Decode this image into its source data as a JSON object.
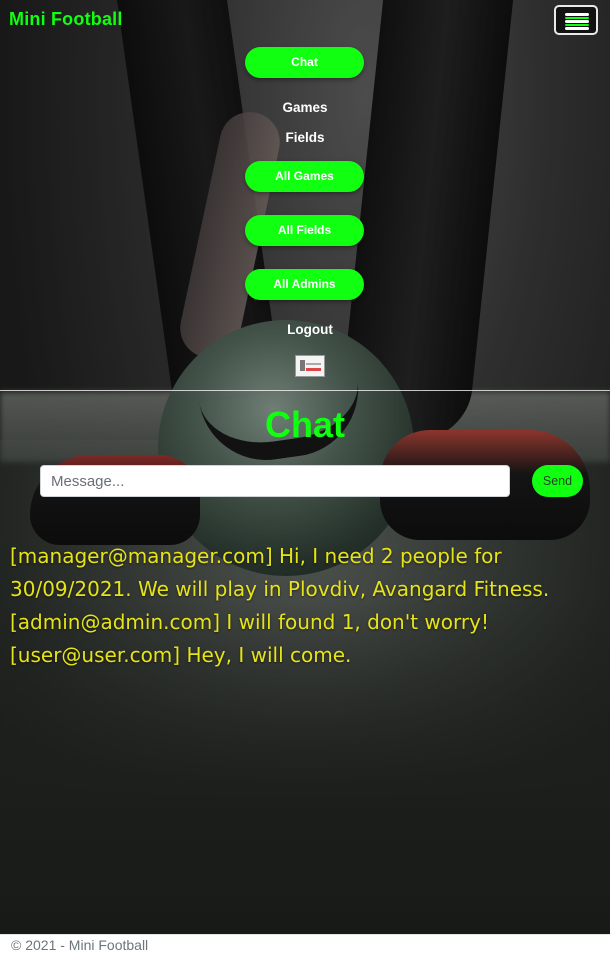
{
  "navbar": {
    "brand": "Mini Football",
    "toggle_icon": "hamburger-menu-icon",
    "items": [
      {
        "label": "Chat",
        "style": "pill"
      },
      {
        "label": "Games",
        "style": "text"
      },
      {
        "label": "Fields",
        "style": "text"
      },
      {
        "label": "All Games",
        "style": "pill"
      },
      {
        "label": "All Fields",
        "style": "pill"
      },
      {
        "label": "All Admins",
        "style": "pill"
      },
      {
        "label": "Logout",
        "style": "text"
      }
    ],
    "profile_icon": "profile-image-icon"
  },
  "chat": {
    "title": "Chat",
    "input_placeholder": "Message...",
    "send_label": "Send",
    "messages": [
      "[manager@manager.com] Hi, I need 2 people for 30/09/2021. We will play in Plovdiv, Avangard Fitness.",
      "[admin@admin.com] I will found 1, don't worry!",
      "[user@user.com] Hey, I will come."
    ]
  },
  "footer": {
    "copyright": "© 2021 - ",
    "link_text": "Mini Football"
  },
  "colors": {
    "accent": "#11ff11",
    "message_text": "#e6e318",
    "footer_text": "#6c757d"
  }
}
